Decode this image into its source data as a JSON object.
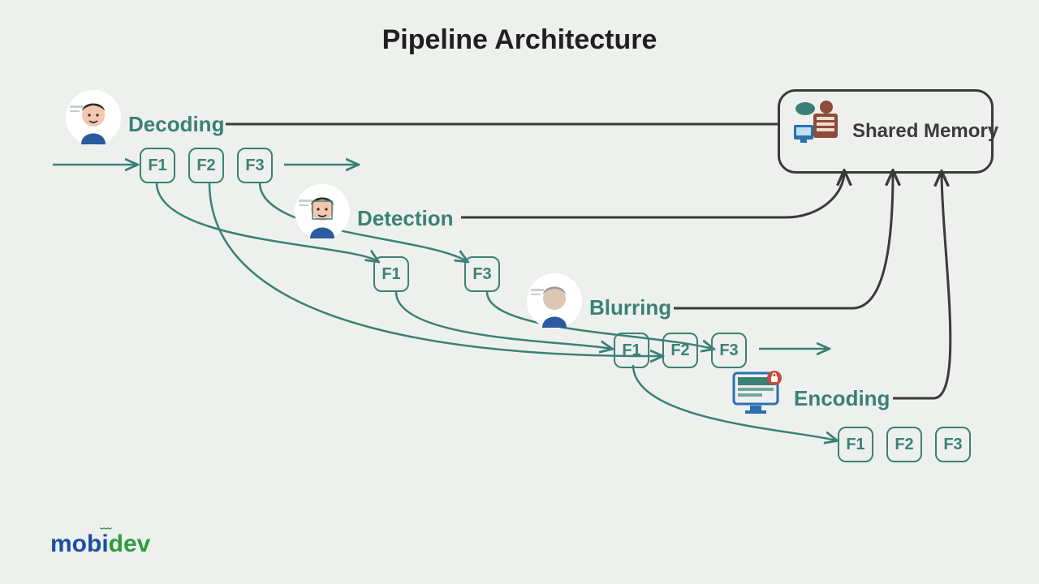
{
  "title": "Pipeline Architecture",
  "stages": {
    "decoding": {
      "label": "Decoding",
      "frames": [
        "F1",
        "F2",
        "F3"
      ]
    },
    "detection": {
      "label": "Detection",
      "frames": [
        "F1",
        "F3"
      ]
    },
    "blurring": {
      "label": "Blurring",
      "frames": [
        "F1",
        "F2",
        "F3"
      ]
    },
    "encoding": {
      "label": "Encoding",
      "frames": [
        "F1",
        "F2",
        "F3"
      ]
    }
  },
  "shared_memory": {
    "label": "Shared Memory"
  },
  "brand": {
    "prefix": "mob",
    "i": "i",
    "suffix": "dev"
  },
  "colors": {
    "accent": "#3b8074",
    "dark": "#3a3a3a"
  }
}
